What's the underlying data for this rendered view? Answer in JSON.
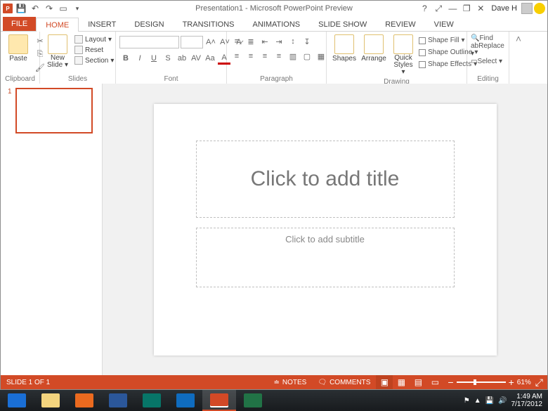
{
  "titlebar": {
    "title": "Presentation1 - Microsoft PowerPoint Preview",
    "user": "Dave H"
  },
  "tabs": {
    "file": "FILE",
    "home": "HOME",
    "insert": "INSERT",
    "design": "DESIGN",
    "transitions": "TRANSITIONS",
    "animations": "ANIMATIONS",
    "slideshow": "SLIDE SHOW",
    "review": "REVIEW",
    "view": "VIEW"
  },
  "ribbon": {
    "clipboard": {
      "label": "Clipboard",
      "paste": "Paste"
    },
    "slides": {
      "label": "Slides",
      "new": "New\nSlide",
      "layout": "Layout",
      "reset": "Reset",
      "section": "Section"
    },
    "font": {
      "label": "Font",
      "name": "",
      "size": ""
    },
    "paragraph": {
      "label": "Paragraph"
    },
    "drawing": {
      "label": "Drawing",
      "shapes": "Shapes",
      "arrange": "Arrange",
      "quick": "Quick\nStyles",
      "fill": "Shape Fill",
      "outline": "Shape Outline",
      "effects": "Shape Effects"
    },
    "editing": {
      "label": "Editing",
      "find": "Find",
      "replace": "Replace",
      "select": "Select"
    }
  },
  "thumb": {
    "num": "1"
  },
  "slide": {
    "title": "Click to add title",
    "subtitle": "Click to add subtitle"
  },
  "status": {
    "slide": "SLIDE 1 OF 1",
    "notes": "NOTES",
    "comments": "COMMENTS",
    "zoom": "61%"
  },
  "tray": {
    "time": "1:49 AM",
    "date": "7/17/2012"
  }
}
